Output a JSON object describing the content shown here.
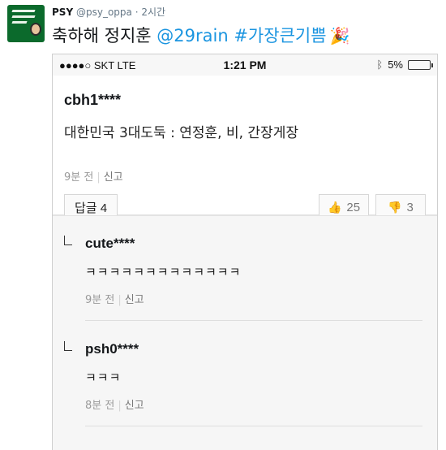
{
  "tweet": {
    "display_name": "PSY",
    "handle": "@psy_oppa",
    "separator": "·",
    "time_ago": "2시간",
    "text_plain": "축하해 정지훈 ",
    "mention": "@29rain",
    "hashtag": " #가장큰기쁨",
    "emoji": "🎉"
  },
  "statusbar": {
    "carrier": "●●●●○ SKT  LTE",
    "time": "1:21 PM",
    "battery": "5%",
    "battery_level": 0.05,
    "battery_color": "#e3312f"
  },
  "comment": {
    "author": "cbh1****",
    "body": "대한민국 3대도둑 : 연정훈, 비, 간장게장",
    "time": "9분 전",
    "report": "신고",
    "reply_label": "답글 4",
    "likes": "25",
    "dislikes": "3"
  },
  "replies": [
    {
      "author": "cute****",
      "body": "ㅋㅋㅋㅋㅋㅋㅋㅋㅋㅋㅋㅋㅋ",
      "time": "9분 전",
      "report": "신고"
    },
    {
      "author": "psh0****",
      "body": "ㅋㅋㅋ",
      "time": "8분 전",
      "report": "신고"
    }
  ],
  "colors": {
    "link": "#1b95e0",
    "avatar_bg": "#0b6a2c"
  }
}
